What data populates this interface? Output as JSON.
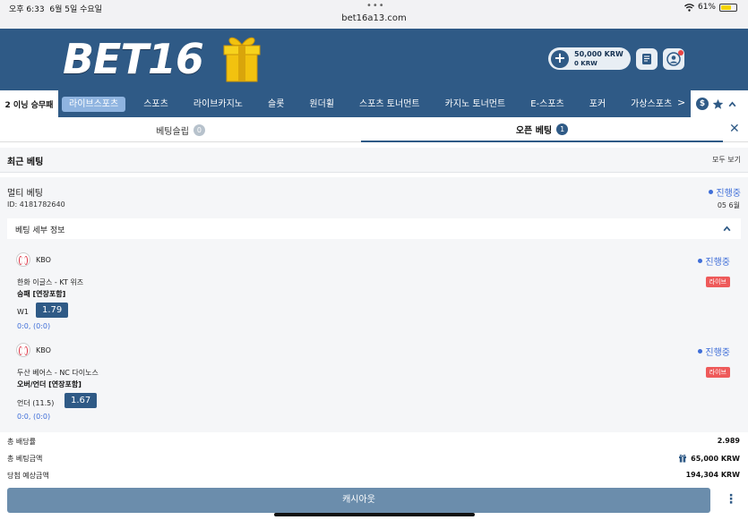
{
  "status_bar": {
    "time": "오후 6:33",
    "date": "6월 5일 수요일",
    "url": "bet16a13.com",
    "battery": "61%"
  },
  "header": {
    "logo_text": "BET",
    "logo_num": "16",
    "balance_main": "50,000 KRW",
    "balance_bonus": "0 KRW"
  },
  "nav": {
    "first": "2 이닝 승무패",
    "items": [
      {
        "label": "라이브스포츠",
        "active": true
      },
      {
        "label": "스포츠"
      },
      {
        "label": "라이브카지노"
      },
      {
        "label": "슬롯"
      },
      {
        "label": "원더휠"
      },
      {
        "label": "스포츠 토너먼트"
      },
      {
        "label": "카지노 토너먼트"
      },
      {
        "label": "E-스포츠"
      },
      {
        "label": "포커"
      },
      {
        "label": "가상스포츠"
      }
    ],
    "more_arrow": ">"
  },
  "tabs": [
    {
      "label": "베팅슬립",
      "count": "0"
    },
    {
      "label": "오픈 베팅",
      "count": "1"
    }
  ],
  "recent": {
    "title": "최근 베팅",
    "view_all": "모두 보기"
  },
  "bet": {
    "type": "멀티 베팅",
    "id": "ID: 4181782640",
    "status": "진행중",
    "date": "05 6월",
    "detail_title": "베팅 세부 정보",
    "selections": [
      {
        "league": "KBO",
        "status": "진행중",
        "teams": "한화 이글스 - KT 위즈",
        "market": "승패 [연장포함]",
        "live": "라이브",
        "pick": "W1",
        "odd": "1.79",
        "score": "0:0, (0:0)"
      },
      {
        "league": "KBO",
        "status": "진행중",
        "teams": "두산 베어스 - NC 다이노스",
        "market": "오버/언더 [연장포함]",
        "live": "라이브",
        "pick": "언더 (11.5)",
        "odd": "1.67",
        "score": "0:0, (0:0)"
      }
    ]
  },
  "totals": {
    "odds_label": "총 배당률",
    "odds_value": "2.989",
    "stake_label": "총 베팅금액",
    "stake_value": "65,000 KRW",
    "payout_label": "당첨 예상금액",
    "payout_value": "194,304 KRW"
  },
  "cashout_label": "캐시아웃",
  "colors": {
    "brand": "#2f5a86",
    "status_blue": "#3f6ed8",
    "live_red": "#ee5a5a",
    "cashout": "#6b8dac"
  }
}
